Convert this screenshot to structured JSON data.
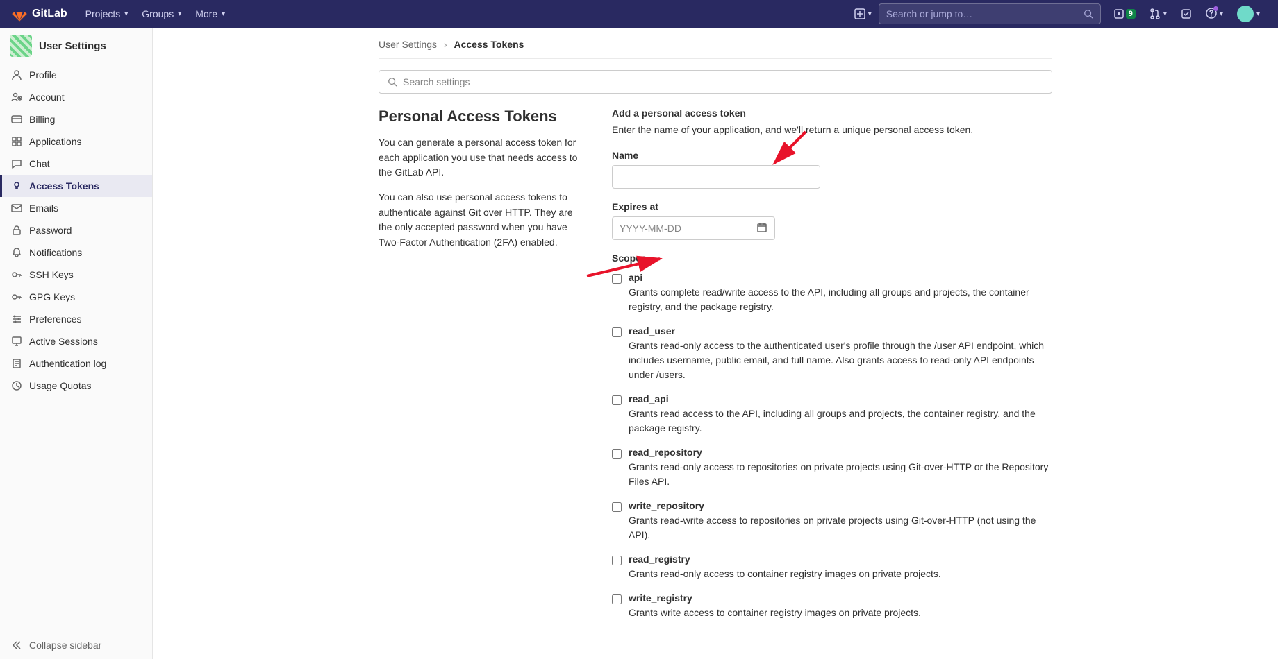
{
  "navbar": {
    "brand": "GitLab",
    "projects": "Projects",
    "groups": "Groups",
    "more": "More",
    "search_placeholder": "Search or jump to…",
    "issues_badge": "9"
  },
  "sidebar": {
    "title": "User Settings",
    "collapse": "Collapse sidebar",
    "items": [
      {
        "label": "Profile"
      },
      {
        "label": "Account"
      },
      {
        "label": "Billing"
      },
      {
        "label": "Applications"
      },
      {
        "label": "Chat"
      },
      {
        "label": "Access Tokens",
        "active": true
      },
      {
        "label": "Emails"
      },
      {
        "label": "Password"
      },
      {
        "label": "Notifications"
      },
      {
        "label": "SSH Keys"
      },
      {
        "label": "GPG Keys"
      },
      {
        "label": "Preferences"
      },
      {
        "label": "Active Sessions"
      },
      {
        "label": "Authentication log"
      },
      {
        "label": "Usage Quotas"
      }
    ]
  },
  "breadcrumbs": {
    "root": "User Settings",
    "current": "Access Tokens"
  },
  "left": {
    "heading": "Personal Access Tokens",
    "p1": "You can generate a personal access token for each application you use that needs access to the GitLab API.",
    "p2": "You can also use personal access tokens to authenticate against Git over HTTP. They are the only accepted password when you have Two-Factor Authentication (2FA) enabled."
  },
  "search_settings_placeholder": "Search settings",
  "form": {
    "section_heading": "Add a personal access token",
    "intro": "Enter the name of your application, and we'll return a unique personal access token.",
    "name_label": "Name",
    "expires_label": "Expires at",
    "expires_placeholder": "YYYY-MM-DD",
    "scopes_label": "Scopes"
  },
  "scopes": [
    {
      "name": "api",
      "desc": "Grants complete read/write access to the API, including all groups and projects, the container registry, and the package registry."
    },
    {
      "name": "read_user",
      "desc": "Grants read-only access to the authenticated user's profile through the /user API endpoint, which includes username, public email, and full name. Also grants access to read-only API endpoints under /users."
    },
    {
      "name": "read_api",
      "desc": "Grants read access to the API, including all groups and projects, the container registry, and the package registry."
    },
    {
      "name": "read_repository",
      "desc": "Grants read-only access to repositories on private projects using Git-over-HTTP or the Repository Files API."
    },
    {
      "name": "write_repository",
      "desc": "Grants read-write access to repositories on private projects using Git-over-HTTP (not using the API)."
    },
    {
      "name": "read_registry",
      "desc": "Grants read-only access to container registry images on private projects."
    },
    {
      "name": "write_registry",
      "desc": "Grants write access to container registry images on private projects."
    }
  ]
}
